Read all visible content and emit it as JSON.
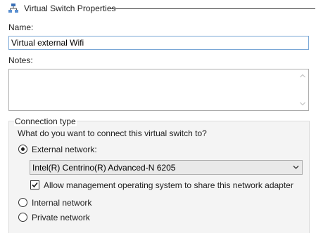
{
  "header": {
    "icon": "virtual-switch-icon",
    "title": "Virtual Switch Properties"
  },
  "name": {
    "label": "Name:",
    "value": "Virtual external Wifi"
  },
  "notes": {
    "label": "Notes:",
    "value": ""
  },
  "connection": {
    "legend": "Connection type",
    "question": "What do you want to connect this virtual switch to?",
    "options": [
      {
        "label": "External network:",
        "selected": true
      },
      {
        "label": "Internal network",
        "selected": false
      },
      {
        "label": "Private network",
        "selected": false
      }
    ],
    "adapter": {
      "selected": "Intel(R) Centrino(R) Advanced-N 6205"
    },
    "share_checkbox": {
      "label": "Allow management operating system to share this network adapter",
      "checked": true
    }
  },
  "colors": {
    "input_focus_border": "#7aa7d6",
    "group_background": "#f4f4f4",
    "dropdown_background": "#e9e9e9"
  }
}
